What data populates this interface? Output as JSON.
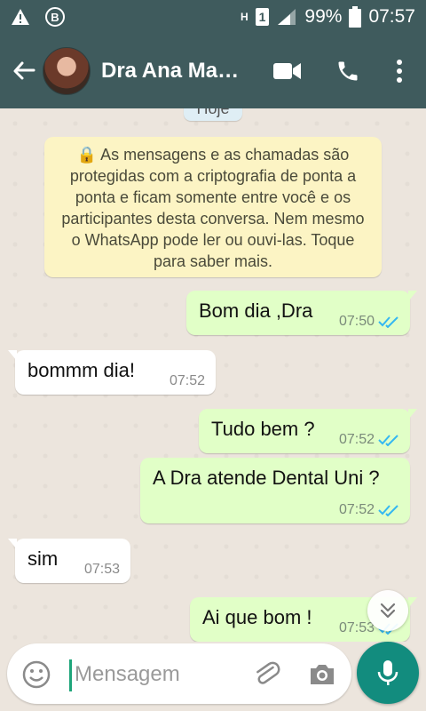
{
  "status_bar": {
    "battery": "99%",
    "time": "07:57",
    "sim_slot": "1",
    "network_indicator": "H"
  },
  "header": {
    "contact_name": "Dra Ana Ma…"
  },
  "chat": {
    "date_chip": "Hoje",
    "encryption_notice": "🔒 As mensagens e as chamadas são protegidas com a criptografia de ponta a ponta e ficam somente entre você e os participantes desta conversa. Nem mesmo o WhatsApp pode ler ou ouvi-las. Toque para saber mais.",
    "messages": [
      {
        "direction": "out",
        "text": "Bom dia ,Dra",
        "time": "07:50",
        "status": "read"
      },
      {
        "direction": "in",
        "text": "bommm dia!",
        "time": "07:52"
      },
      {
        "direction": "out",
        "text": "Tudo bem ?",
        "time": "07:52",
        "status": "read"
      },
      {
        "direction": "out",
        "text": "A Dra atende Dental Uni ?",
        "time": "07:52",
        "status": "read"
      },
      {
        "direction": "in",
        "text": "sim",
        "time": "07:53"
      },
      {
        "direction": "out",
        "text": "Ai que bom !",
        "time": "07:53",
        "status": "read"
      }
    ]
  },
  "composer": {
    "placeholder": "Mensagem"
  },
  "colors": {
    "app_bar": "#3F5B5D",
    "outgoing_bubble": "#E1FFC7",
    "incoming_bubble": "#FFFFFF",
    "notice_bg": "#FCF4C4",
    "accent": "#128C7E",
    "read_ticks": "#34B7F1"
  },
  "icons": [
    "warning-icon",
    "b-circle-icon",
    "signal-icon",
    "battery-icon",
    "back-arrow-icon",
    "video-call-icon",
    "phone-icon",
    "more-vert-icon",
    "lock-icon",
    "double-check-icon",
    "chevron-double-down-icon",
    "emoji-icon",
    "attach-icon",
    "camera-icon",
    "mic-icon"
  ]
}
